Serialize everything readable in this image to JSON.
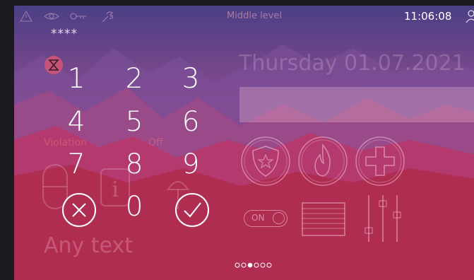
{
  "topbar": {
    "level_label": "Middle level",
    "time": "11:06:08",
    "icons": [
      "warning-icon",
      "eye-icon",
      "key-icon",
      "wrench-icon",
      "user-icon"
    ]
  },
  "keypad": {
    "pin_mask": "****",
    "keys": [
      "1",
      "2",
      "3",
      "4",
      "5",
      "6",
      "7",
      "8",
      "9",
      "0"
    ],
    "cancel_icon": "x-circle-icon",
    "confirm_icon": "check-circle-icon",
    "timer_icon": "hourglass-icon"
  },
  "background_widgets": {
    "date": "Thursday 01.07.2021",
    "violation_label": "Violation",
    "off_label": "Off",
    "any_text": "Any text",
    "toggle_label": "ON",
    "buttons": [
      "police-icon",
      "fire-icon",
      "medical-icon"
    ],
    "controls": [
      "toggle-switch-icon",
      "shutter-icon",
      "equalizer-sliders-icon"
    ]
  },
  "pager": {
    "total": 6,
    "active": 2
  },
  "colors": {
    "sky": "#7a4a8c",
    "mountain_dark": "#b02d52",
    "foreground_text": "#ffffff"
  }
}
